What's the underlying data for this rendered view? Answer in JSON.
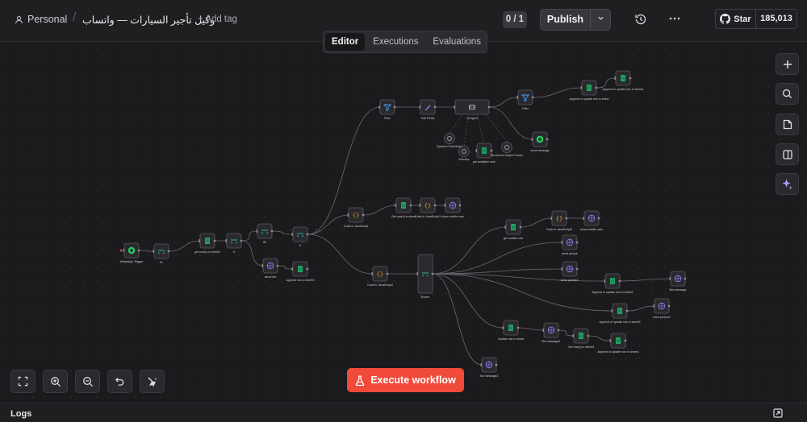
{
  "header": {
    "project": "Personal",
    "workflow_name": "وكيل تأجير السيارات — واتساب",
    "add_tag": "+ Add tag",
    "counter": "0 / 1",
    "publish_label": "Publish",
    "github_star": "Star",
    "github_count": "185,013"
  },
  "tabs": [
    {
      "label": "Editor"
    },
    {
      "label": "Executions"
    },
    {
      "label": "Evaluations"
    }
  ],
  "execute_label": "Execute workflow",
  "logs_title": "Logs",
  "colors": {
    "accent": "#ef4a3a",
    "node_bg": "#2a2a2e",
    "edge": "#6b6b70",
    "sheet_green": "#1fa463",
    "whatsapp_green": "#25d366",
    "switch_teal": "#2bb3a6",
    "code_orange": "#f59f0b",
    "http_purple": "#8b7cf6",
    "filter_blue": "#4aa3ff"
  },
  "nodes": [
    {
      "id": "n1",
      "label": "WhatsApp Trigger",
      "kind": "whatsapp"
    },
    {
      "id": "n2",
      "label": "If1",
      "kind": "switch"
    },
    {
      "id": "n3",
      "label": "get row(s) in sheet2",
      "kind": "sheet"
    },
    {
      "id": "n4",
      "label": "If",
      "kind": "switch"
    },
    {
      "id": "n5",
      "label": "If2",
      "kind": "switch"
    },
    {
      "id": "n6",
      "label": "If",
      "kind": "switch"
    },
    {
      "id": "n7",
      "label": "send text",
      "kind": "http"
    },
    {
      "id": "n8",
      "label": "Append row in sheet3",
      "kind": "sheet"
    },
    {
      "id": "n9",
      "label": "Filter",
      "kind": "filter"
    },
    {
      "id": "n10",
      "label": "Edit Fields",
      "kind": "edit"
    },
    {
      "id": "n11",
      "label": "AI Agent",
      "kind": "agent"
    },
    {
      "id": "n12",
      "label": "Filter",
      "kind": "filter"
    },
    {
      "id": "n13",
      "label": "Append or update row in sheet",
      "kind": "sheet"
    },
    {
      "id": "n14",
      "label": "Append or update row in sheet1",
      "kind": "sheet"
    },
    {
      "id": "n15",
      "label": "send message",
      "kind": "whatsapp"
    },
    {
      "id": "n16",
      "label": "Speech Chat Model",
      "kind": "sub"
    },
    {
      "id": "n17",
      "label": "Memory",
      "kind": "sub"
    },
    {
      "id": "n18",
      "label": "get available cars",
      "kind": "sheet"
    },
    {
      "id": "n19",
      "label": "Structured Output Parser",
      "kind": "sub"
    },
    {
      "id": "n20",
      "label": "Code in JavaScript",
      "kind": "code"
    },
    {
      "id": "n21",
      "label": "Get row(s) in sheet",
      "kind": "sheet"
    },
    {
      "id": "n22",
      "label": "Code in JavaScript1",
      "kind": "code"
    },
    {
      "id": "n23",
      "label": "show mobile cars",
      "kind": "http"
    },
    {
      "id": "n24",
      "label": "Code in JavaScript2",
      "kind": "code"
    },
    {
      "id": "n25",
      "label": "Router",
      "kind": "switch"
    },
    {
      "id": "n26",
      "label": "get mobile cars",
      "kind": "sheet"
    },
    {
      "id": "n27",
      "label": "Code in JavaScript3",
      "kind": "code"
    },
    {
      "id": "n28",
      "label": "show mobile cars",
      "kind": "http"
    },
    {
      "id": "n29",
      "label": "send picture",
      "kind": "http"
    },
    {
      "id": "n30",
      "label": "send picture1",
      "kind": "http"
    },
    {
      "id": "n31",
      "label": "Append or update row in sheet2",
      "kind": "sheet"
    },
    {
      "id": "n32",
      "label": "Bot message",
      "kind": "http"
    },
    {
      "id": "n33",
      "label": "Append or update row in sheet3",
      "kind": "sheet"
    },
    {
      "id": "n34",
      "label": "send picture2",
      "kind": "http"
    },
    {
      "id": "n35",
      "label": "Update row in sheet",
      "kind": "sheet"
    },
    {
      "id": "n36",
      "label": "Bot message1",
      "kind": "http"
    },
    {
      "id": "n37",
      "label": "Get row(s) in sheet3",
      "kind": "sheet"
    },
    {
      "id": "n38",
      "label": "Append or update row in sheet4",
      "kind": "sheet"
    },
    {
      "id": "n39",
      "label": "Bot message2",
      "kind": "http"
    }
  ],
  "edges": [
    [
      "n1",
      "n2"
    ],
    [
      "n2",
      "n3"
    ],
    [
      "n3",
      "n4"
    ],
    [
      "n4",
      "n5"
    ],
    [
      "n4",
      "n7"
    ],
    [
      "n7",
      "n8"
    ],
    [
      "n5",
      "n6"
    ],
    [
      "n6",
      "n9"
    ],
    [
      "n9",
      "n10"
    ],
    [
      "n10",
      "n11"
    ],
    [
      "n11",
      "n12"
    ],
    [
      "n12",
      "n13"
    ],
    [
      "n13",
      "n14"
    ],
    [
      "n11",
      "n15"
    ],
    [
      "n6",
      "n20"
    ],
    [
      "n20",
      "n21"
    ],
    [
      "n21",
      "n22"
    ],
    [
      "n22",
      "n23"
    ],
    [
      "n6",
      "n24"
    ],
    [
      "n24",
      "n25"
    ],
    [
      "n25",
      "n26"
    ],
    [
      "n26",
      "n27"
    ],
    [
      "n27",
      "n28"
    ],
    [
      "n25",
      "n29"
    ],
    [
      "n25",
      "n30"
    ],
    [
      "n25",
      "n31"
    ],
    [
      "n31",
      "n32"
    ],
    [
      "n25",
      "n33"
    ],
    [
      "n33",
      "n34"
    ],
    [
      "n25",
      "n35"
    ],
    [
      "n35",
      "n36"
    ],
    [
      "n36",
      "n37"
    ],
    [
      "n37",
      "n38"
    ],
    [
      "n25",
      "n39"
    ]
  ]
}
